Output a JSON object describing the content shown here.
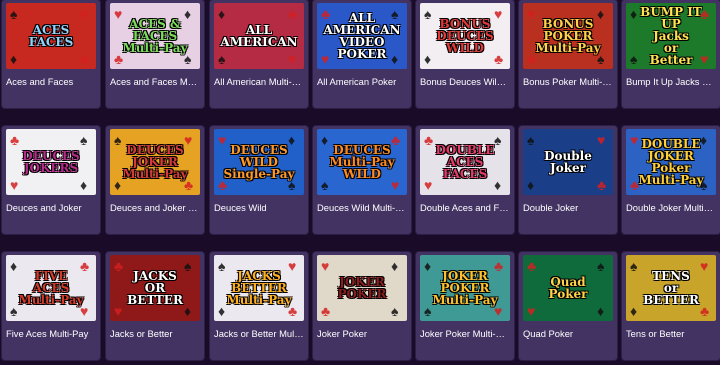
{
  "games": [
    {
      "title": "Aces and Faces",
      "thumb_text": "ACES\nFACES",
      "bg": "#c7281f",
      "fg": "#8fd3ff"
    },
    {
      "title": "Aces and Faces Multi-Pay",
      "thumb_text": "ACES &\nFACES\nMulti-Pay",
      "bg": "#e7cfe4",
      "fg": "#7bdc5a"
    },
    {
      "title": "All American Multi-Pay",
      "thumb_text": "ALL\nAMERICAN",
      "bg": "#b52b43",
      "fg": "#ffffff"
    },
    {
      "title": "All American Poker",
      "thumb_text": "ALL\nAMERICAN\nVIDEO POKER",
      "bg": "#2b58c8",
      "fg": "#ffffff"
    },
    {
      "title": "Bonus Deuces Wild Multi-Pay",
      "thumb_text": "BONUS\nDEUCES\nWILD",
      "bg": "#f2eef2",
      "fg": "#e03a3a"
    },
    {
      "title": "Bonus Poker Multi-Pay",
      "thumb_text": "BONUS\nPOKER\nMulti-Pay",
      "bg": "#b92f20",
      "fg": "#ffd24a"
    },
    {
      "title": "Bump It Up Jacks or Better",
      "thumb_text": "BUMP IT UP\nJacks\nor\nBetter",
      "bg": "#1d7a2a",
      "fg": "#ffe352"
    },
    {
      "title": "Deuces and Joker",
      "thumb_text": "DEUCES\nJOKERS",
      "bg": "#f1f1f4",
      "fg": "#b52a8a"
    },
    {
      "title": "Deuces and Joker Multi-Pay",
      "thumb_text": "DEUCES\nJOKER\nMulti-Pay",
      "bg": "#e6a223",
      "fg": "#d43b3b"
    },
    {
      "title": "Deuces Wild",
      "thumb_text": "DEUCES\nWILD\nSingle-Pay",
      "bg": "#2060c8",
      "fg": "#ff9a2a"
    },
    {
      "title": "Deuces Wild Multi-Pay",
      "thumb_text": "DEUCES\nMulti-Pay\nWILD",
      "bg": "#2a66d0",
      "fg": "#ff8a20"
    },
    {
      "title": "Double Aces and Faces Multi-Pay",
      "thumb_text": "DOUBLE\nACES\nFACES",
      "bg": "#e6e2ea",
      "fg": "#e53c6a"
    },
    {
      "title": "Double Joker",
      "thumb_text": "Double\nJoker",
      "bg": "#1b3e88",
      "fg": "#ffffff"
    },
    {
      "title": "Double Joker Multi-Pay",
      "thumb_text": "DOUBLE JOKER\nPoker\nMulti-Pay",
      "bg": "#2c62c4",
      "fg": "#ffcf3a"
    },
    {
      "title": "Five Aces Multi-Pay",
      "thumb_text": "FIVE\nACES\nMulti-Pay",
      "bg": "#ece8ef",
      "fg": "#d23a2a"
    },
    {
      "title": "Jacks or Better",
      "thumb_text": "JACKS\nOR\nBETTER",
      "bg": "#8f1919",
      "fg": "#ffffff"
    },
    {
      "title": "Jacks or Better Multi-Pay",
      "thumb_text": "JACKS\nBETTER\nMulti-Pay",
      "bg": "#ece8ef",
      "fg": "#ffb020"
    },
    {
      "title": "Joker Poker",
      "thumb_text": "JOKER\nPOKER",
      "bg": "#e0d8c9",
      "fg": "#8a1e1e"
    },
    {
      "title": "Joker Poker Multi-Pay",
      "thumb_text": "JOKER\nPOKER\nMulti-Pay",
      "bg": "#3f9a95",
      "fg": "#ffc22c"
    },
    {
      "title": "Quad Poker",
      "thumb_text": "Quad\nPoker",
      "bg": "#0f6b3b",
      "fg": "#ffd24a"
    },
    {
      "title": "Tens or Better",
      "thumb_text": "TENS\nor\nBETTER",
      "bg": "#c8a42a",
      "fg": "#ffffff"
    }
  ]
}
